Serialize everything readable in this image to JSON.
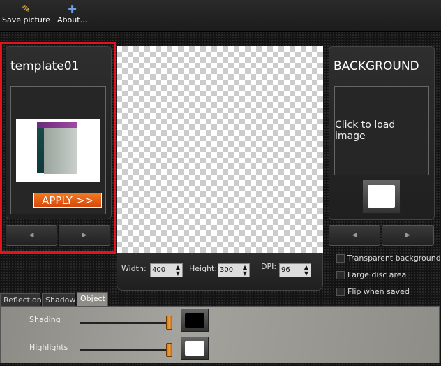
{
  "toolbar": {
    "save_label": "Save picture",
    "about_label": "About..."
  },
  "template": {
    "title": "template01",
    "apply_label": "APPLY >>",
    "prev": "◀",
    "next": "▶"
  },
  "size": {
    "width_label": "Width:",
    "width_value": "400",
    "height_label": "Height:",
    "height_value": "300",
    "dpi_label": "DPI:",
    "dpi_value": "96"
  },
  "background": {
    "title": "BACKGROUND",
    "load_label": "Click to load image",
    "swatch_color": "#ffffff",
    "prev": "◀",
    "next": "▶"
  },
  "options": [
    {
      "label": "Transparent background",
      "checked": false
    },
    {
      "label": "Large disc area",
      "checked": false
    },
    {
      "label": "Flip when saved",
      "checked": false
    }
  ],
  "tabs": [
    {
      "label": "Reflection",
      "active": false
    },
    {
      "label": "Shadow",
      "active": false
    },
    {
      "label": "Object",
      "active": true
    }
  ],
  "object": {
    "shading_label": "Shading",
    "shading_value": 100,
    "shading_color": "#000000",
    "highlights_label": "Highlights",
    "highlights_value": 100,
    "highlights_color": "#ffffff"
  },
  "colors": {
    "selection_border": "#e0141a",
    "apply_button": "#e8560c"
  }
}
